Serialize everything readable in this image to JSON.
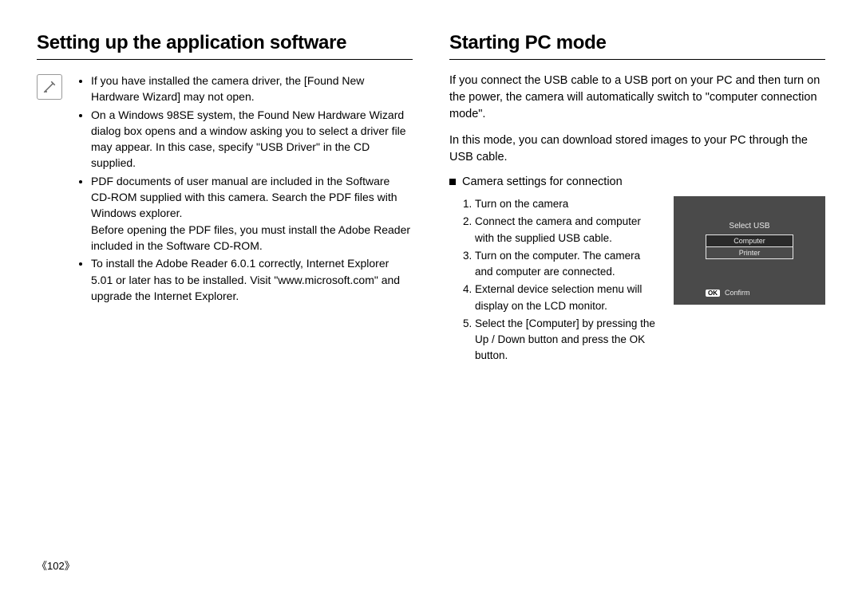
{
  "left": {
    "heading": "Setting up the application software",
    "bullets": [
      {
        "main": "If you have installed the camera driver, the [Found New Hardware Wizard] may not open."
      },
      {
        "main": "On a Windows 98SE system, the Found New Hardware Wizard dialog box opens and a window asking you to select a driver file may appear. In this case, specify \"USB Driver\" in the CD supplied."
      },
      {
        "main": "PDF documents of user manual are included in the Software CD-ROM supplied with this camera. Search the PDF files with Windows explorer.",
        "follow": "Before opening the PDF files, you must install the Adobe Reader included in the Software CD-ROM."
      },
      {
        "main": "To install the Adobe Reader 6.0.1 correctly, Internet Explorer 5.01 or later has to be installed. Visit \"www.microsoft.com\" and upgrade the Internet Explorer."
      }
    ]
  },
  "right": {
    "heading": "Starting PC mode",
    "para1": "If you connect the USB cable to a USB port on your PC and then turn on the power, the camera will automatically switch to \"computer connection mode\".",
    "para2": "In this mode, you can download stored images to your PC through the USB cable.",
    "subhead": "Camera settings for connection",
    "steps": [
      "Turn on the camera",
      "Connect the camera and computer with the supplied USB cable.",
      "Turn on the computer. The camera and computer are connected.",
      "External device selection menu will display on the LCD monitor.",
      "Select the [Computer] by pressing the Up / Down button and press the OK button."
    ],
    "lcd": {
      "title": "Select USB",
      "items": [
        "Computer",
        "Printer"
      ],
      "selected_index": 0,
      "ok": "OK",
      "confirm": "Confirm"
    }
  },
  "page_number": "《102》"
}
